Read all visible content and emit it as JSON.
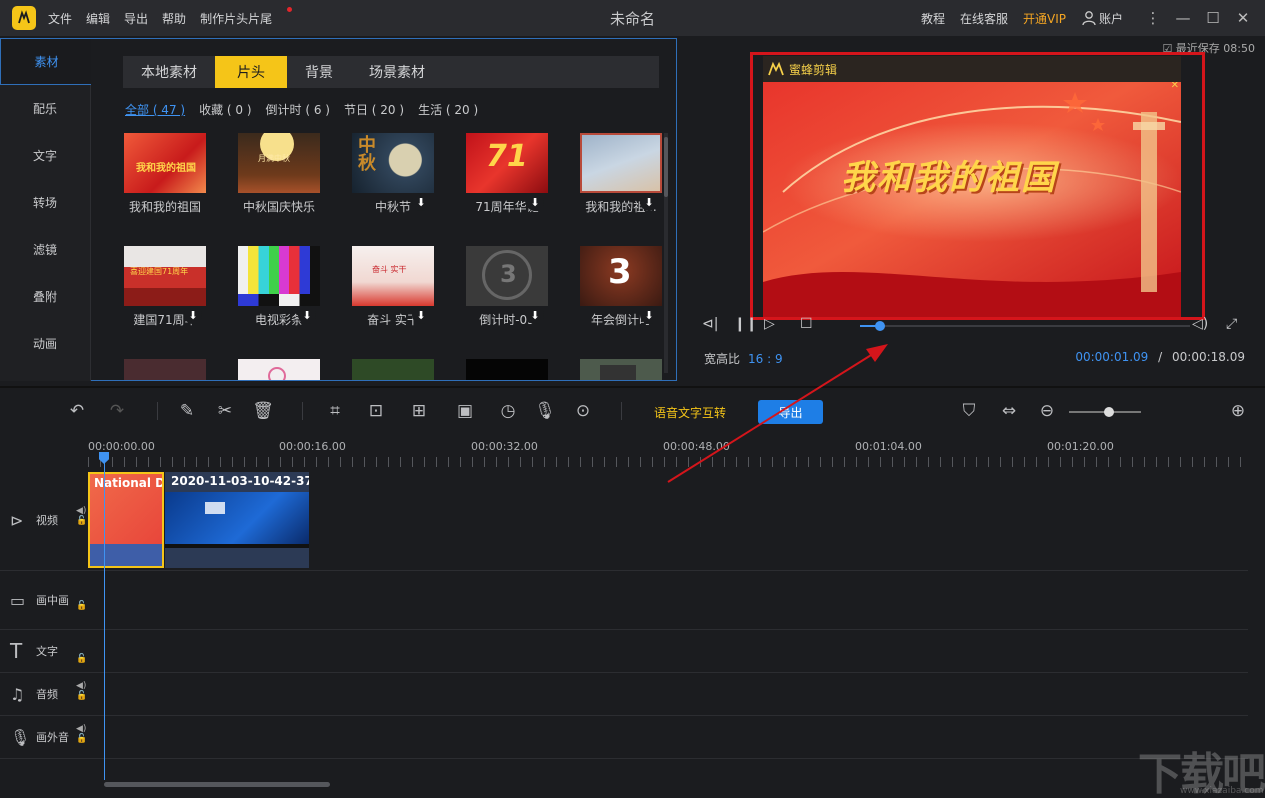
{
  "app": {
    "title": "未命名",
    "menus": [
      "文件",
      "编辑",
      "导出",
      "帮助",
      "制作片头片尾"
    ],
    "right_links": {
      "tutorial": "教程",
      "service": "在线客服",
      "vip": "开通VIP",
      "account": "账户"
    }
  },
  "sidebar": {
    "items": [
      "素材",
      "配乐",
      "文字",
      "转场",
      "滤镜",
      "叠附",
      "动画"
    ],
    "active": 0
  },
  "panel": {
    "tabs": [
      "本地素材",
      "片头",
      "背景",
      "场景素材"
    ],
    "active_tab": 1,
    "filters": [
      "全部 ( 47 )",
      "收藏 ( 0 )",
      "倒计时 ( 6 )",
      "节日 ( 20 )",
      "生活 ( 20 )"
    ],
    "cards": [
      {
        "label": "我和我的祖国",
        "icon": "flag-red-thumb",
        "download": false
      },
      {
        "label": "中秋国庆快乐",
        "icon": "moon-festival-thumb",
        "download": false
      },
      {
        "label": "中秋节",
        "icon": "mid-autumn-thumb",
        "download": true
      },
      {
        "label": "71周年华诞",
        "icon": "anniversary-71-thumb",
        "download": true
      },
      {
        "label": "我和我的祖...",
        "icon": "landscape-thumb",
        "download": true
      },
      {
        "label": "建国71周年",
        "icon": "tiananmen-thumb",
        "download": true
      },
      {
        "label": "电视彩条",
        "icon": "tv-color-bars-thumb",
        "download": true
      },
      {
        "label": "奋斗 实干",
        "icon": "struggle-thumb",
        "download": true
      },
      {
        "label": "倒计时-03",
        "icon": "countdown-film-thumb",
        "download": true
      },
      {
        "label": "年会倒计时",
        "icon": "countdown-3-thumb",
        "download": true
      },
      {
        "label": "",
        "icon": "card-thumb"
      },
      {
        "label": "",
        "icon": "card-thumb"
      },
      {
        "label": "",
        "icon": "card-thumb"
      },
      {
        "label": "",
        "icon": "card-thumb"
      },
      {
        "label": "",
        "icon": "card-thumb"
      }
    ]
  },
  "preview": {
    "autosave": "最近保存 08:50",
    "brand": "蜜蜂剪辑",
    "video_title": "我和我的祖国",
    "ratio_label": "宽高比",
    "ratio_value": "16 : 9",
    "current_time": "00:00:01.09",
    "separator": "/",
    "total_time": "00:00:18.09",
    "progress": 0.06
  },
  "toolbar": {
    "speech_text": "语音文字互转",
    "export_label": "导出"
  },
  "timeline": {
    "ticks": [
      "00:00:00.00",
      "00:00:16.00",
      "00:00:32.00",
      "00:00:48.00",
      "00:01:04.00",
      "00:01:20.00"
    ],
    "tracks": [
      "视频",
      "画中画",
      "文字",
      "音频",
      "画外音"
    ],
    "clips": [
      {
        "label": "National D"
      },
      {
        "label": "2020-11-03-10-42-37"
      }
    ]
  },
  "watermark": {
    "text": "下载吧",
    "url": "www.xiazaiba.com"
  },
  "colors": {
    "accent": "#f5c518",
    "blue": "#3f93f2",
    "highlight": "#d4151b"
  }
}
